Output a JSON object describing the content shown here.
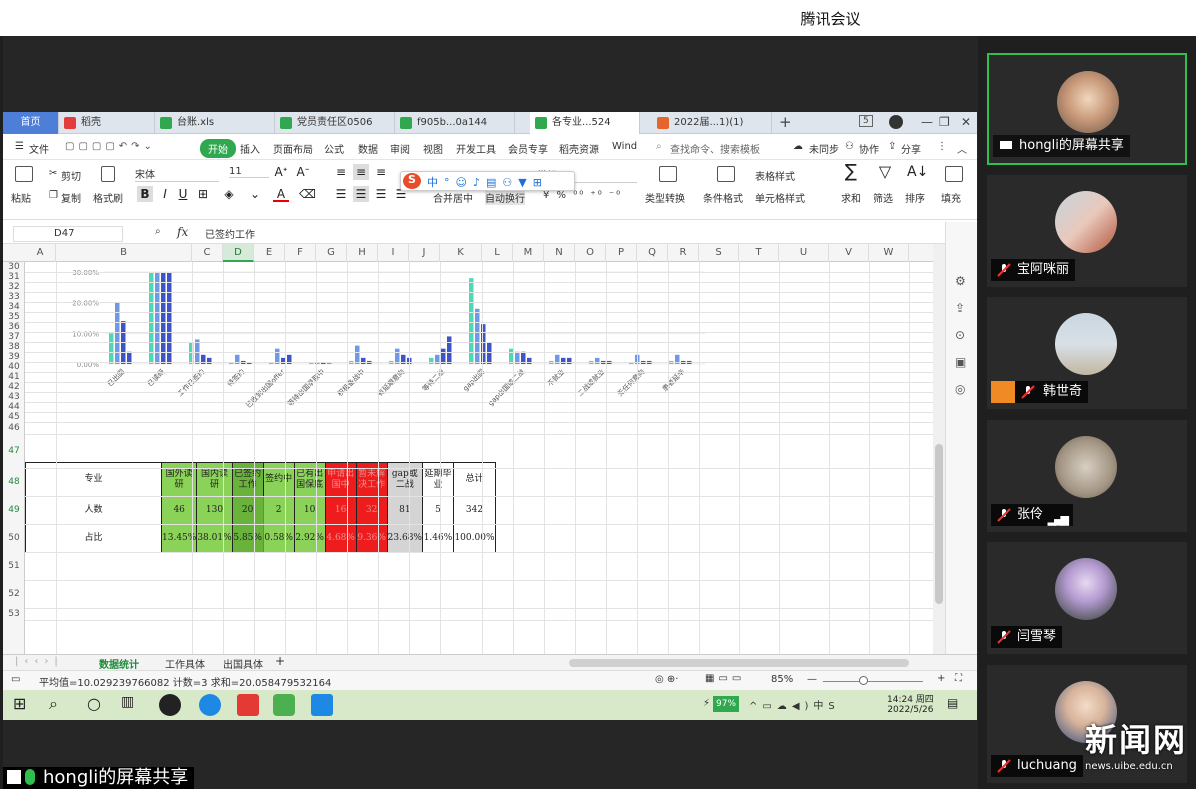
{
  "meeting": {
    "title": "腾讯会议",
    "share_label": "hongli的屏幕共享"
  },
  "app": {
    "tabs": [
      {
        "label": "首页"
      },
      {
        "label": "稻壳"
      },
      {
        "label": "台账.xls"
      },
      {
        "label": "党员责任区0506"
      },
      {
        "label": "f905b...0a144"
      },
      {
        "label": "各专业...524"
      },
      {
        "label": "2022届...1)(1)"
      }
    ],
    "tab_add": "+",
    "window_controls": [
      "5",
      "—",
      "❐",
      "✕"
    ],
    "menu": {
      "file": "文件",
      "start": "开始",
      "insert": "插入",
      "layout": "页面布局",
      "formula": "公式",
      "data": "数据",
      "review": "审阅",
      "view": "视图",
      "dev": "开发工具",
      "member": "会员专享",
      "docer": "稻壳资源",
      "wind": "Wind",
      "search_placeholder": "查找命令、搜索模板",
      "sync": "未同步",
      "collab": "协作",
      "share": "分享"
    },
    "ribbon": {
      "paste": "粘贴",
      "cut": "剪切",
      "copy": "复制",
      "format_painter": "格式刷",
      "font": "宋体",
      "size": "11",
      "merge": "合并居中",
      "wrap": "自动换行",
      "number_fmt": "常规",
      "convert": "类型转换",
      "cond_fmt": "条件格式",
      "table_style": "表格样式",
      "cell_style": "单元格样式",
      "sum": "求和",
      "filter": "筛选",
      "sort": "排序",
      "fill": "填充"
    },
    "formula_bar": {
      "cell_ref": "D47",
      "fx": "fx",
      "value": "已签约工作"
    },
    "columns": [
      "A",
      "B",
      "C",
      "D",
      "E",
      "F",
      "G",
      "H",
      "I",
      "J",
      "K",
      "L",
      "M",
      "N",
      "O",
      "P",
      "Q",
      "R",
      "S",
      "T",
      "U",
      "V",
      "W"
    ],
    "selected_column": "D",
    "rows": [
      "30",
      "31",
      "32",
      "33",
      "34",
      "35",
      "36",
      "37",
      "38",
      "39",
      "40",
      "41",
      "42",
      "43",
      "44",
      "45",
      "46",
      "47",
      "48",
      "49",
      "50",
      "51",
      "52",
      "53"
    ],
    "chart_data": {
      "type": "bar",
      "ylim": [
        0,
        30
      ],
      "yticks": [
        "30.00%",
        "20.00%",
        "10.00%",
        "0.00%"
      ],
      "categories": [
        "已出国",
        "已读研",
        "工作已签约",
        "待签约",
        "已收到出国offer",
        "等待出国录取中",
        "积极备战中",
        "有延期意向",
        "等待二战",
        "gap出国",
        "gap出国或二战",
        "不就业",
        "二战或就业",
        "无任何意向",
        "患者延毕"
      ],
      "series": [
        {
          "color": "#4fd8b8",
          "values": [
            10,
            40,
            7,
            0.5,
            0.5,
            0.3,
            1,
            1,
            2,
            28,
            5,
            1,
            1,
            0.5,
            1
          ]
        },
        {
          "color": "#6f98e8",
          "values": [
            20,
            40,
            8,
            3,
            5,
            0.5,
            6,
            5,
            3,
            18,
            4,
            3,
            2,
            3,
            3
          ]
        },
        {
          "color": "#3e55c8",
          "values": [
            14,
            40,
            3,
            1,
            2,
            0.5,
            2,
            3,
            5,
            13,
            4,
            2,
            1,
            1,
            1
          ]
        },
        {
          "color": "#3e55c8",
          "values": [
            4,
            40,
            2,
            0.5,
            3,
            0.2,
            1,
            2,
            9,
            7,
            2,
            2,
            1,
            1,
            1
          ]
        }
      ]
    },
    "table": {
      "headers": [
        "专业",
        "国外读研",
        "国内读研",
        "已签约工作",
        "签约中",
        "已有出国保底",
        "申请出国中",
        "暂未解决工作",
        "gap或二战",
        "延期毕业",
        "总计"
      ],
      "count_row": [
        "人数",
        "46",
        "130",
        "20",
        "2",
        "10",
        "16",
        "32",
        "81",
        "5",
        "342"
      ],
      "ratio_row": [
        "占比",
        "13.45%",
        "38.01%",
        "5.85%",
        "0.58%",
        "2.92%",
        "4.68%",
        "9.36%",
        "23.68%",
        "1.46%",
        "100.00%"
      ]
    },
    "sheets": [
      "数据统计",
      "工作具体",
      "出国具体"
    ],
    "status": {
      "text": "平均值=10.029239766082 计数=3 求和=20.058479532164",
      "zoom": "85%"
    },
    "taskbar": {
      "battery": "97%",
      "time": "14:24 周四",
      "date": "2022/5/26"
    }
  },
  "participants": [
    {
      "name": "hongli的屏幕共享",
      "active": true
    },
    {
      "name": "宝阿咪丽"
    },
    {
      "name": "韩世奇"
    },
    {
      "name": "张伶"
    },
    {
      "name": "闫雪琴"
    },
    {
      "name": "luchuang"
    }
  ],
  "watermark": {
    "big": "新闻网",
    "small": "news.uibe.edu.cn"
  }
}
